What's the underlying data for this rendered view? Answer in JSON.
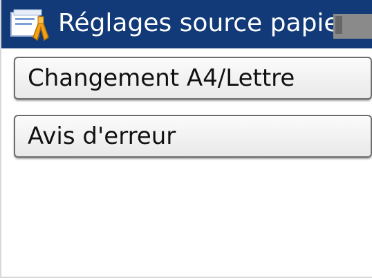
{
  "header": {
    "title": "Réglages source papier",
    "icon": "paper-settings-icon",
    "background_color": "#123a78"
  },
  "menu": {
    "items": [
      {
        "label": "Changement A4/Lettre"
      },
      {
        "label": "Avis d'erreur"
      }
    ]
  }
}
